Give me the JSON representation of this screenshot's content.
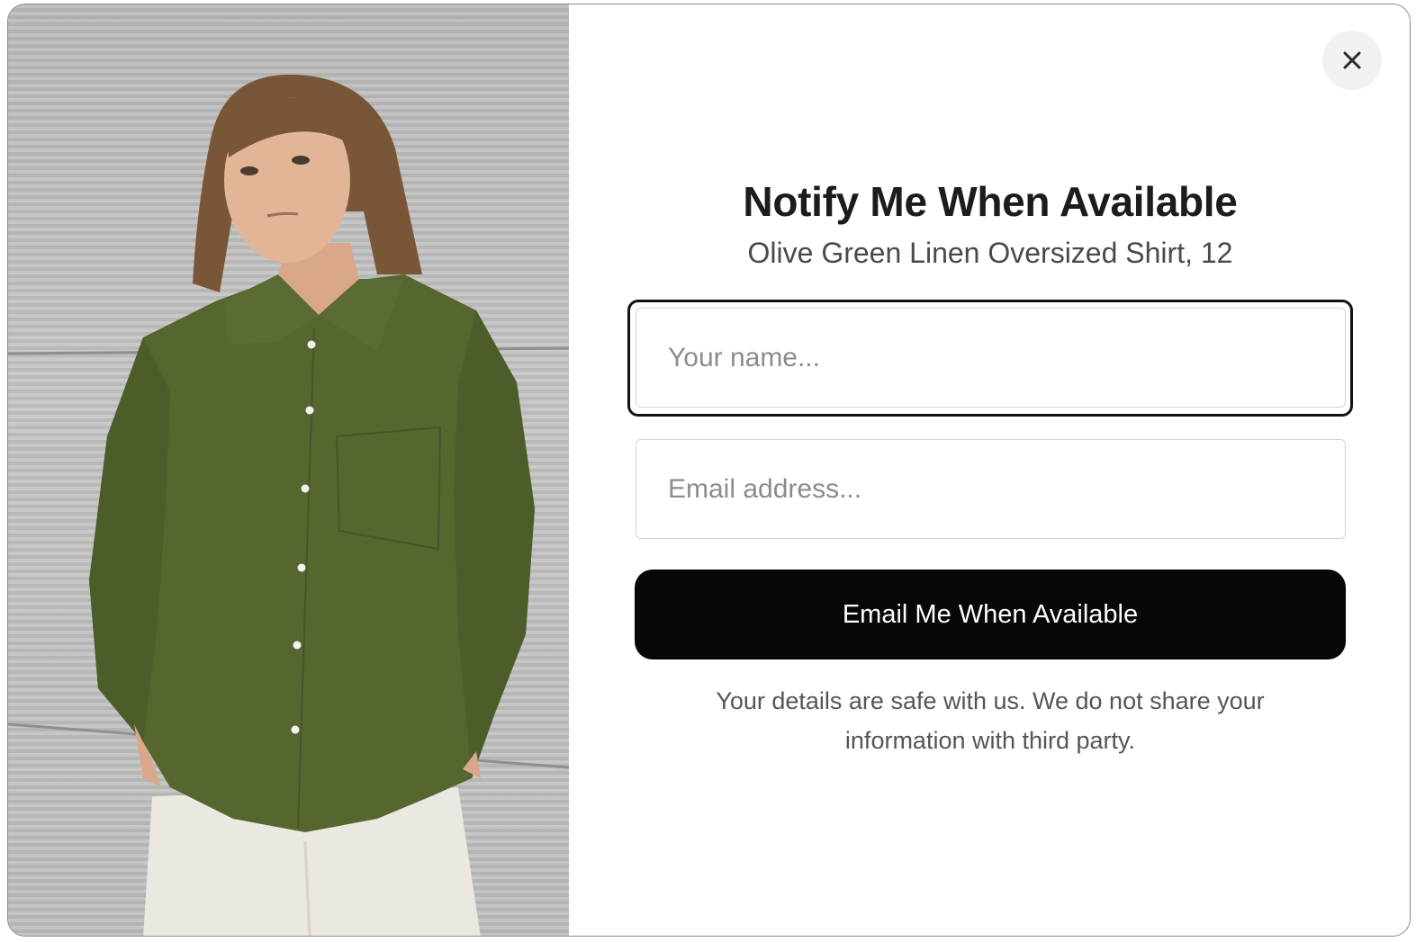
{
  "modal": {
    "close_icon": "close-icon",
    "photo_icon": "product-photo",
    "title": "Notify Me When Available",
    "subtitle": "Olive Green Linen Oversized Shirt, 12",
    "form": {
      "name_placeholder": "Your name...",
      "name_value": "",
      "email_placeholder": "Email address...",
      "email_value": "",
      "submit_label": "Email Me When Available"
    },
    "privacy_note": "Your details are safe with us. We do not share your information with third party."
  },
  "colors": {
    "button_bg": "#050708",
    "button_text": "#ffffff",
    "title": "#1c1c1c",
    "shirt": "#55662f"
  }
}
